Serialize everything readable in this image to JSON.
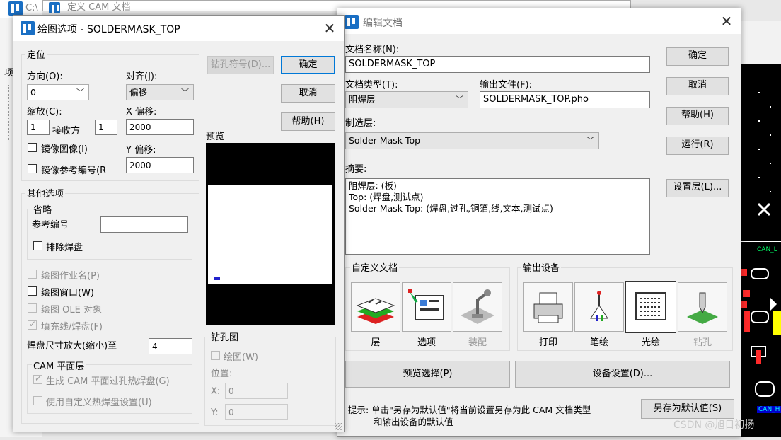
{
  "background": {
    "bg_title_left": "C:\\",
    "bg_title_mid": "定义 CAM 文档",
    "bg_side_label": "项"
  },
  "left_dialog": {
    "title": "绘图选项 - SOLDERMASK_TOP",
    "group_position": "定位",
    "direction_label": "方向(O):",
    "direction_value": "0",
    "align_label": "对齐(J):",
    "align_value": "偏移",
    "scale_label": "缩放(C):",
    "scale_value1": "1",
    "scale_mid_label": "接收方",
    "scale_value2": "1",
    "x_offset_label": "X 偏移:",
    "x_offset_value": "2000",
    "y_offset_label": "Y 偏移:",
    "y_offset_value": "2000",
    "mirror_image": "镜像图像(I)",
    "mirror_ref": "镜像参考编号(R",
    "drill_symbol_btn": "钻孔符号(D)...",
    "ok_btn": "确定",
    "cancel_btn": "取消",
    "help_btn": "帮助(H)",
    "preview_label": "预览",
    "group_other": "其他选项",
    "group_omit": "省略",
    "ref_label": "参考编号",
    "exclude_pads": "排除焊盘",
    "plot_job_name": "绘图作业名(P)",
    "plot_window": "绘图窗口(W)",
    "plot_ole": "绘图 OLE 对象",
    "fill_lines": "填充线/焊盘(F)",
    "pad_scale_label": "焊盘尺寸放大(缩小)至",
    "pad_scale_value": "4",
    "group_cam": "CAM 平面层",
    "cam_thermal": "生成 CAM 平面过孔热焊盘(G)",
    "cam_custom": "使用自定义热焊盘设置(U)",
    "group_drill": "钻孔图",
    "drill_plot": "绘图(W)",
    "drill_position": "位置:",
    "drill_x_label": "X:",
    "drill_x_value": "0",
    "drill_y_label": "Y:",
    "drill_y_value": "0"
  },
  "right_dialog": {
    "title": "编辑文档",
    "doc_name_label": "文档名称(N):",
    "doc_name_value": "SOLDERMASK_TOP",
    "doc_type_label": "文档类型(T):",
    "doc_type_value": "阻焊层",
    "output_file_label": "输出文件(F):",
    "output_file_value": "SOLDERMASK_TOP.pho",
    "fab_layer_label": "制造层:",
    "fab_layer_value": "Solder Mask Top",
    "summary_label": "摘要:",
    "summary_line1": "阻焊层: (板)",
    "summary_line2": "Top: (焊盘,测试点)",
    "summary_line3": "Solder Mask Top: (焊盘,过孔,铜箔,线,文本,测试点)",
    "ok_btn": "确定",
    "cancel_btn": "取消",
    "help_btn": "帮助(H)",
    "run_btn": "运行(R)",
    "layers_btn": "设置层(L)...",
    "custom_doc_group": "自定义文档",
    "output_device_group": "输出设备",
    "tool_layers": "层",
    "tool_options": "选项",
    "tool_assembly": "装配",
    "tool_print": "打印",
    "tool_pen": "笔绘",
    "tool_photo": "光绘",
    "tool_drill": "钻孔",
    "preview_select_btn": "预览选择(P)",
    "device_setup_btn": "设备设置(D)...",
    "hint_line1": "提示: 单击\"另存为默认值\"将当前设置另存为此 CAM 文档类型",
    "hint_line2": "和输出设备的默认值",
    "save_default_btn": "另存为默认值(S)"
  },
  "board": {
    "label1": "CAN_L",
    "label2": "CAN_H"
  },
  "watermark": "CSDN @旭日初扬"
}
